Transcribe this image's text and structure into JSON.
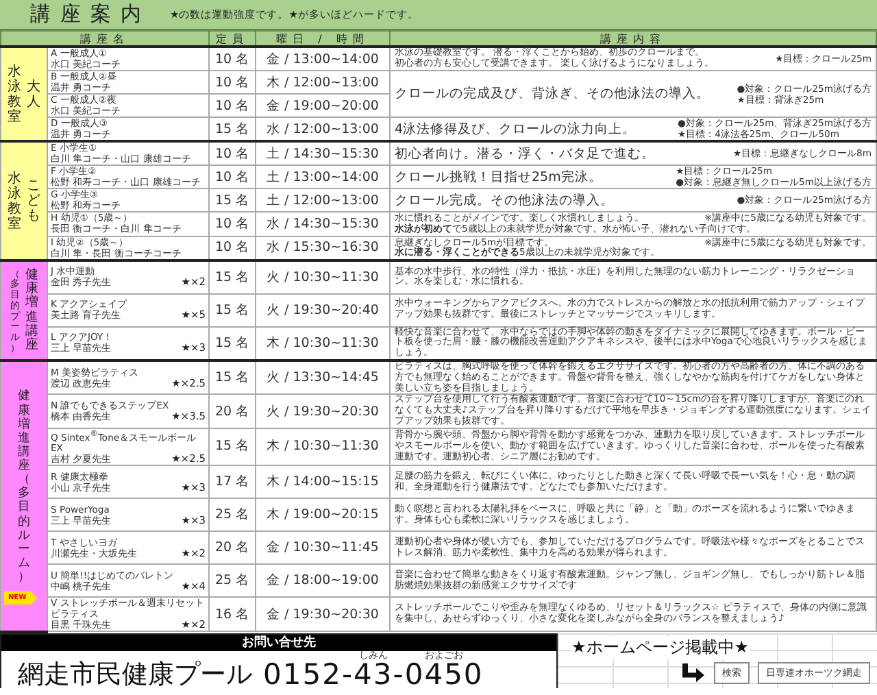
{
  "header": {
    "title": "講座案内",
    "hint": "★の数は運動強度です。★が多いほどハードです。"
  },
  "columns": [
    "講座名",
    "定員",
    "曜日 / 時間",
    "講座内容"
  ],
  "groups": [
    {
      "label_columns": [
        "水泳教室",
        "大人"
      ],
      "color": "#ffff99",
      "courses": [
        {
          "name": "A 一般成人①",
          "teacher": "水口 美紀コーチ",
          "capacity": "10 名",
          "schedule": "金 / 13:00~14:00",
          "content": {
            "kind": "paragraph",
            "text": [
              "水泳の基礎教室です。 潜る・浮くことから始め、初歩のクロールまで。",
              "初心者の方も安心して受講できます。 楽しく泳げるようになりましょう。"
            ],
            "note": [
              "★目標：クロール25m"
            ]
          }
        },
        {
          "name": "B 一般成人②昼",
          "teacher": "温井 勇コーチ",
          "capacity": "10 名",
          "schedule": "木 / 12:00~13:00",
          "content": {
            "kind": "headline",
            "text": [
              "クロールの完成及び、背泳ぎ、その他泳法の導入。"
            ],
            "note": [
              "●対象：クロール25m泳げる方",
              "★目標：背泳ぎ25m"
            ]
          }
        },
        {
          "name": "C 一般成人②夜",
          "teacher": "水口 美紀コーチ",
          "capacity": "10 名",
          "schedule": "金 / 19:00~20:00"
        },
        {
          "name": "D 一般成人③",
          "teacher": "温井 勇コーチ",
          "capacity": "15 名",
          "schedule": "水 / 12:00~13:00",
          "content": {
            "kind": "headline",
            "text": [
              "4泳法修得及び、クロールの泳力向上。"
            ],
            "note": [
              "●対象：クロール25m、背泳ぎ25m泳げる方",
              "★目標：4泳法各25m、クロール50m"
            ]
          }
        }
      ]
    },
    {
      "label_columns": [
        "水泳教室",
        "こども"
      ],
      "color": "#ffff99",
      "courses": [
        {
          "name": "E 小学生①",
          "teacher": "白川 隼コーチ・山口 康雄コーチ",
          "capacity": "10 名",
          "schedule": "土 / 14:30~15:30",
          "content": {
            "kind": "headline",
            "text": [
              "初心者向け。潜る・浮く・バタ足で進む。"
            ],
            "note": [
              "★目標：息継ぎなしクロール8m"
            ]
          }
        },
        {
          "name": "F 小学生②",
          "teacher": "松野 和寿コーチ・山口 康雄コーチ",
          "capacity": "10 名",
          "schedule": "土 / 13:00~14:00",
          "content": {
            "kind": "headline",
            "text": [
              "クロール挑戦！目指せ25m完泳。"
            ],
            "note": [
              "★目標：クロール25m",
              "●対象：息継ぎ無しクロール5m以上泳げる方"
            ]
          }
        },
        {
          "name": "G 小学生③",
          "teacher": "松野 和寿コーチ",
          "capacity": "15 名",
          "schedule": "土 / 12:00~13:00",
          "content": {
            "kind": "headline",
            "text": [
              "クロール完成。その他泳法の導入。"
            ],
            "note": [
              "●対象：クロール25m泳げる方"
            ]
          }
        },
        {
          "name": "H 幼児①（5歳～）",
          "teacher": "長田 衡コーチ・白川 隼コーチ",
          "capacity": "10 名",
          "schedule": "水 / 14:30~15:30",
          "content": {
            "kind": "lead",
            "text": [
              "水に慣れることがメインです。楽しく水慣れしましょう。",
              "**水泳が初めて**で5歳以上の未就学児が対象です。水が怖い子、潜れない子向けです。"
            ],
            "note": [
              "※講座中に5歳になる幼児も対象です。"
            ]
          }
        },
        {
          "name": "I 幼児②（5歳～）",
          "teacher": "白川 隼・長田 衡コーチコーチ",
          "capacity": "10 名",
          "schedule": "水 / 15:30~16:30",
          "content": {
            "kind": "lead",
            "text": [
              "息継ぎなしクロール5mが目標です。",
              "**水に潜る・浮くことができる**5歳以上の未就学児が対象です。"
            ],
            "note": [
              "※講座中に5歳になる幼児も対象です。"
            ]
          }
        }
      ]
    },
    {
      "label_columns": [
        "（多目的プール）",
        "健康増進講座"
      ],
      "color": "#ff88ff",
      "courses": [
        {
          "name": "J 水中運動",
          "teacher": "金田 秀子先生",
          "intensity": "★×2",
          "capacity": "15 名",
          "schedule": "火 / 10:30~11:30",
          "content": {
            "kind": "paragraph",
            "text": [
              "基本の水中歩行、水の特性（浮力・抵抗・水圧）を利用した無理のない筋力トレーニング・リラクゼーション。水を楽しむ・水に慣れる。"
            ]
          }
        },
        {
          "name": "K アクアシェイプ",
          "teacher": "美土路 育子先生",
          "intensity": "★×5",
          "capacity": "15 名",
          "schedule": "火 / 19:30~20:40",
          "content": {
            "kind": "paragraph",
            "text": [
              "水中ウォーキングからアクアビクスへ。水の力でストレスからの解放と水の抵抗利用で筋力アップ・シェイプアップ効果も抜群です。最後にストレッチとマッサージでスッキリします。"
            ]
          }
        },
        {
          "name": "L アクアJOY！",
          "teacher": "三上 早苗先生",
          "intensity": "★×3",
          "capacity": "15 名",
          "schedule": "木 / 10:30~11:30",
          "content": {
            "kind": "paragraph",
            "text": [
              "軽快な音楽に合わせて、水中ならではの手脚や体幹の動きをダイナミックに展開してゆきます。ボール・ビート板を使った肩・腰・膝の機能改善運動アクアキネシスや、後半には水中Yogaで心地良いリラックスを感じましょう。"
            ]
          }
        }
      ]
    },
    {
      "label_columns": [
        "健康増進講座（多目的ルーム）"
      ],
      "color": "#ff88ff",
      "badge": "NEW",
      "courses": [
        {
          "name": "M 美姿勢ピラティス",
          "teacher": "渡辺 政恵先生",
          "intensity": "★×2.5",
          "capacity": "15 名",
          "schedule": "火 / 13:30~14:45",
          "content": {
            "kind": "paragraph",
            "text": [
              "ピラティスは、胸式呼吸を使って体幹を鍛えるエクササイズです。初心者の方や高齢者の方、体に不調のある方でも無理なく始めることができます。骨盤や背骨を整え、強くしなやかな筋肉を付けてケガをしない身体と美しい立ち姿を目指しましょう。"
            ]
          }
        },
        {
          "name": "N 誰でもできるステップEX",
          "teacher": "橋本 由香先生",
          "intensity": "★×3.5",
          "capacity": "20 名",
          "schedule": "火 / 19:30~20:30",
          "content": {
            "kind": "paragraph",
            "text": [
              "ステップ台を使用して行う有酸素運動です。音楽に合わせて10～15cmの台を昇り降りしますが、音楽にのれなくても大丈夫♪ステップ台を昇り降りするだけで平地を早歩き・ジョギングする運動強度になります。シェイプアップ効果も抜群です。"
            ]
          }
        },
        {
          "name": "Q Sintex$^{®}$Tone＆スモールボールEX",
          "teacher": "吉村 夕夏先生",
          "intensity": "★×2.5",
          "capacity": "15 名",
          "schedule": "木 / 10:30~11:30",
          "content": {
            "kind": "paragraph",
            "text": [
              "背骨から腕や頭、骨盤から脚や背骨を動かす感覚をつかみ、連動力を取り戻していきます。ストレッチポールやスモールボールを使い、動かす範囲を広げていきます。ゆっくりした音楽に合わせ、ボールを使った有酸素運動です。運動初心者、シニア層にお勧めです。"
            ]
          }
        },
        {
          "name": "R 健康太極拳",
          "teacher": "小山 京子先生",
          "intensity": "★×3",
          "capacity": "17 名",
          "schedule": "木 / 14:00~15:15",
          "content": {
            "kind": "paragraph",
            "text": [
              "足腰の筋力を鍛え、転びにくい体に。ゆったりとした動きと深くて長い呼吸で長ーい気を！心・息・動の調和、全身運動を行う健康法です。どなたでも参加いただけます。"
            ]
          }
        },
        {
          "name": "S PowerYoga",
          "teacher": "三上 早苗先生",
          "intensity": "★×3",
          "capacity": "25 名",
          "schedule": "木 / 19:00~20:15",
          "content": {
            "kind": "paragraph",
            "text": [
              "動く瞑想と言われる太陽礼拝をベースに、呼吸と共に「静」と「動」のポーズを流れるように繋いでゆきます。身体も心も柔軟に深いリラックスを感じましょう。"
            ]
          }
        },
        {
          "name": "T やさしいヨガ",
          "teacher": "川瀬先生・大坂先生",
          "intensity": "★×2",
          "capacity": "20 名",
          "schedule": "金 / 10:30~11:45",
          "content": {
            "kind": "paragraph",
            "text": [
              "運動初心者や身体が硬い方でも、参加していただけるプログラムです。呼吸法や様々なポーズをとることでストレス解消、筋力や柔軟性、集中力を高める効果が得られます。"
            ]
          }
        },
        {
          "name": "U 簡単!!はじめてのバレトン",
          "teacher": "中嶋 桃子先生",
          "intensity": "★×4",
          "capacity": "25 名",
          "schedule": "金 / 18:00~19:00",
          "content": {
            "kind": "paragraph",
            "text": [
              "音楽に合わせて簡単な動きをくり返す有酸素運動。ジャンプ無し、ジョギング無し、でもしっかり筋トレ＆脂肪燃焼効果抜群の新感覚エクササイズです"
            ]
          }
        },
        {
          "name": "V ストレッチポール＆週末リセットピラティス",
          "teacher": "目黒 千珠先生",
          "intensity": "★×2",
          "capacity": "16 名",
          "schedule": "金 / 19:30~20:30",
          "content": {
            "kind": "paragraph",
            "text": [
              "ストレッチポールでこりや歪みを無理なくゆるめ、リセット＆リラックス☆ ピラティスで、身体の内側に意識を集中し、あせらずゆっくり、小さな変化を楽しみながら全身のバランスを整えましょう♪"
            ]
          }
        }
      ]
    }
  ],
  "contact": {
    "heading": "お問い合せ先",
    "facility": "網走市民健康プール",
    "phone": [
      {
        "text": "0152-"
      },
      {
        "text": "43",
        "reading": "しみん"
      },
      {
        "text": "-"
      },
      {
        "text": "0450",
        "reading": "およごお"
      }
    ]
  },
  "homepage": {
    "banner": "★ホームページ掲載中★",
    "search_button": "検索",
    "search_value": "日専連オホーツク網走"
  }
}
